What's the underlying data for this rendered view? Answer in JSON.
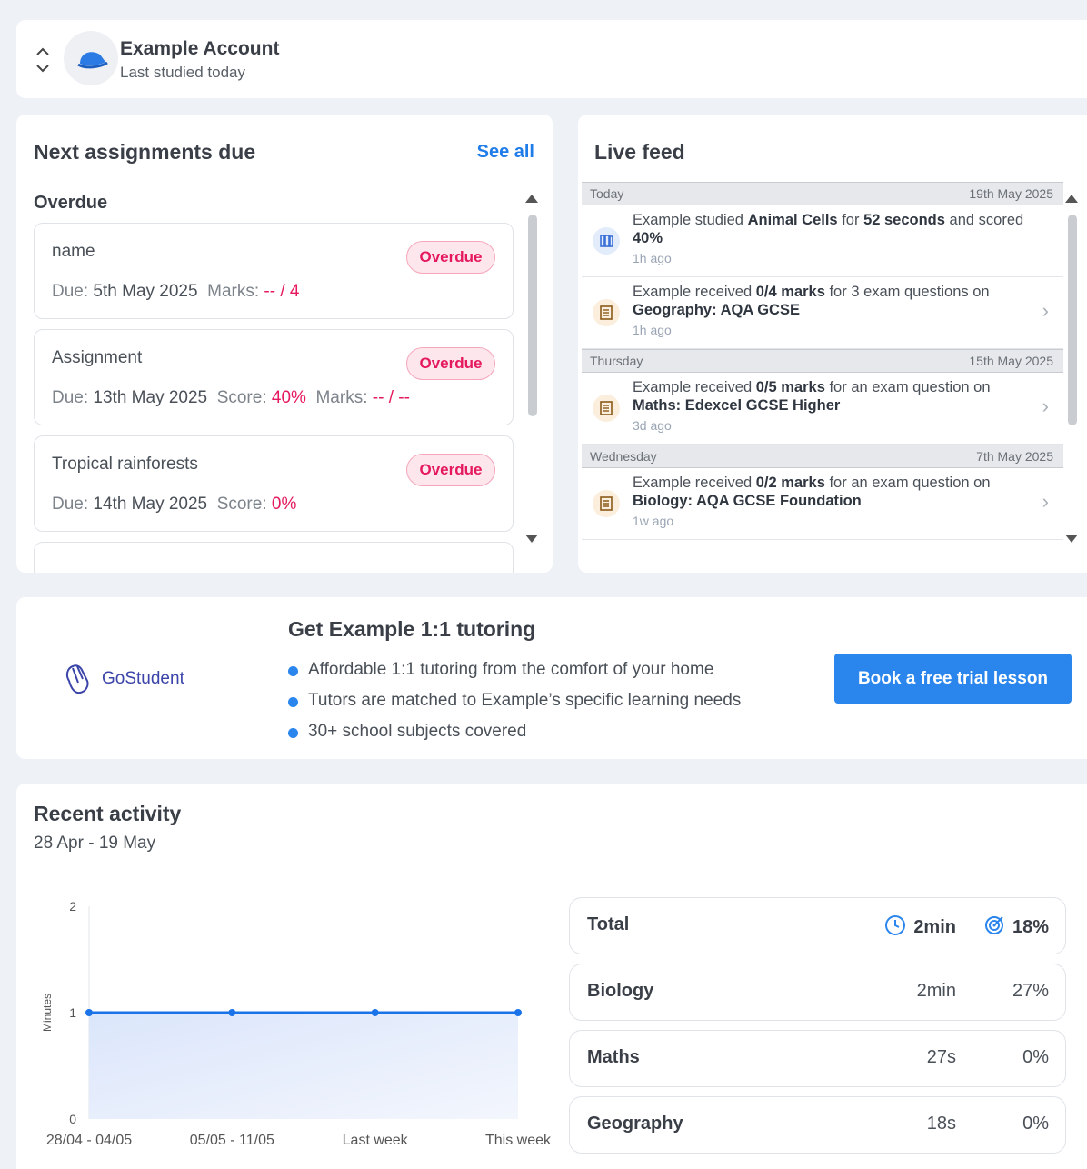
{
  "account": {
    "name": "Example Account",
    "last_studied": "Last studied today"
  },
  "assignments": {
    "title": "Next assignments due",
    "see_all": "See all",
    "section": "Overdue",
    "items": [
      {
        "name": "name",
        "badge": "Overdue",
        "due_label": "Due:",
        "due": "5th May 2025",
        "score_label": "",
        "score": "",
        "marks_label": "Marks:",
        "marks": "-- / 4"
      },
      {
        "name": "Assignment",
        "badge": "Overdue",
        "due_label": "Due:",
        "due": "13th May 2025",
        "score_label": "Score:",
        "score": "40%",
        "marks_label": "Marks:",
        "marks": "-- / --"
      },
      {
        "name": "Tropical rainforests",
        "badge": "Overdue",
        "due_label": "Due:",
        "due": "14th May 2025",
        "score_label": "Score:",
        "score": "0%",
        "marks_label": "",
        "marks": ""
      }
    ]
  },
  "feed": {
    "title": "Live feed",
    "groups": [
      {
        "day": "Today",
        "date": "19th May 2025"
      },
      {
        "day": "Thursday",
        "date": "15th May 2025"
      },
      {
        "day": "Wednesday",
        "date": "7th May 2025"
      }
    ],
    "items": [
      {
        "a": "Example studied ",
        "b": "Animal Cells",
        "c": " for ",
        "d": "52 seconds",
        "e": " and scored ",
        "f": "40%",
        "ago": "1h ago",
        "icon": "books-icon"
      },
      {
        "a": "Example received ",
        "b": "0/4 marks",
        "c": " for 3 exam questions on ",
        "d": "Geography: AQA GCSE",
        "ago": "1h ago",
        "icon": "scroll-icon"
      },
      {
        "a": "Example received ",
        "b": "0/5 marks",
        "c": " for an exam question on ",
        "d": "Maths: Edexcel GCSE Higher",
        "ago": "3d ago",
        "icon": "scroll-icon"
      },
      {
        "a": "Example received ",
        "b": "0/2 marks",
        "c": " for an exam question on ",
        "d": "Biology: AQA GCSE Foundation",
        "ago": "1w ago",
        "icon": "scroll-icon"
      }
    ]
  },
  "tutoring": {
    "brand": "GoStudent",
    "title": "Get Example 1:1 tutoring",
    "bullets": [
      "Affordable 1:1 tutoring from the comfort of your home",
      "Tutors are matched to Example’s specific learning needs",
      "30+ school subjects covered"
    ],
    "cta": "Book a free trial lesson"
  },
  "activity": {
    "title": "Recent activity",
    "range": "28 Apr - 19 May",
    "stats": [
      {
        "name": "Total",
        "time": "2min",
        "pct": "18%"
      },
      {
        "name": "Biology",
        "time": "2min",
        "pct": "27%"
      },
      {
        "name": "Maths",
        "time": "27s",
        "pct": "0%"
      },
      {
        "name": "Geography",
        "time": "18s",
        "pct": "0%"
      }
    ]
  },
  "chart_data": {
    "type": "area",
    "categories": [
      "28/04 - 04/05",
      "05/05 - 11/05",
      "Last week",
      "This week"
    ],
    "series": [
      {
        "values": [
          1,
          1,
          1,
          1
        ]
      }
    ],
    "ylabel": "Minutes",
    "ylim": [
      0,
      2
    ],
    "yticks": [
      0,
      1,
      2
    ],
    "color": "#1a73e8"
  },
  "colors": {
    "accent": "#2a86ec",
    "overdue": "#e5195f"
  }
}
